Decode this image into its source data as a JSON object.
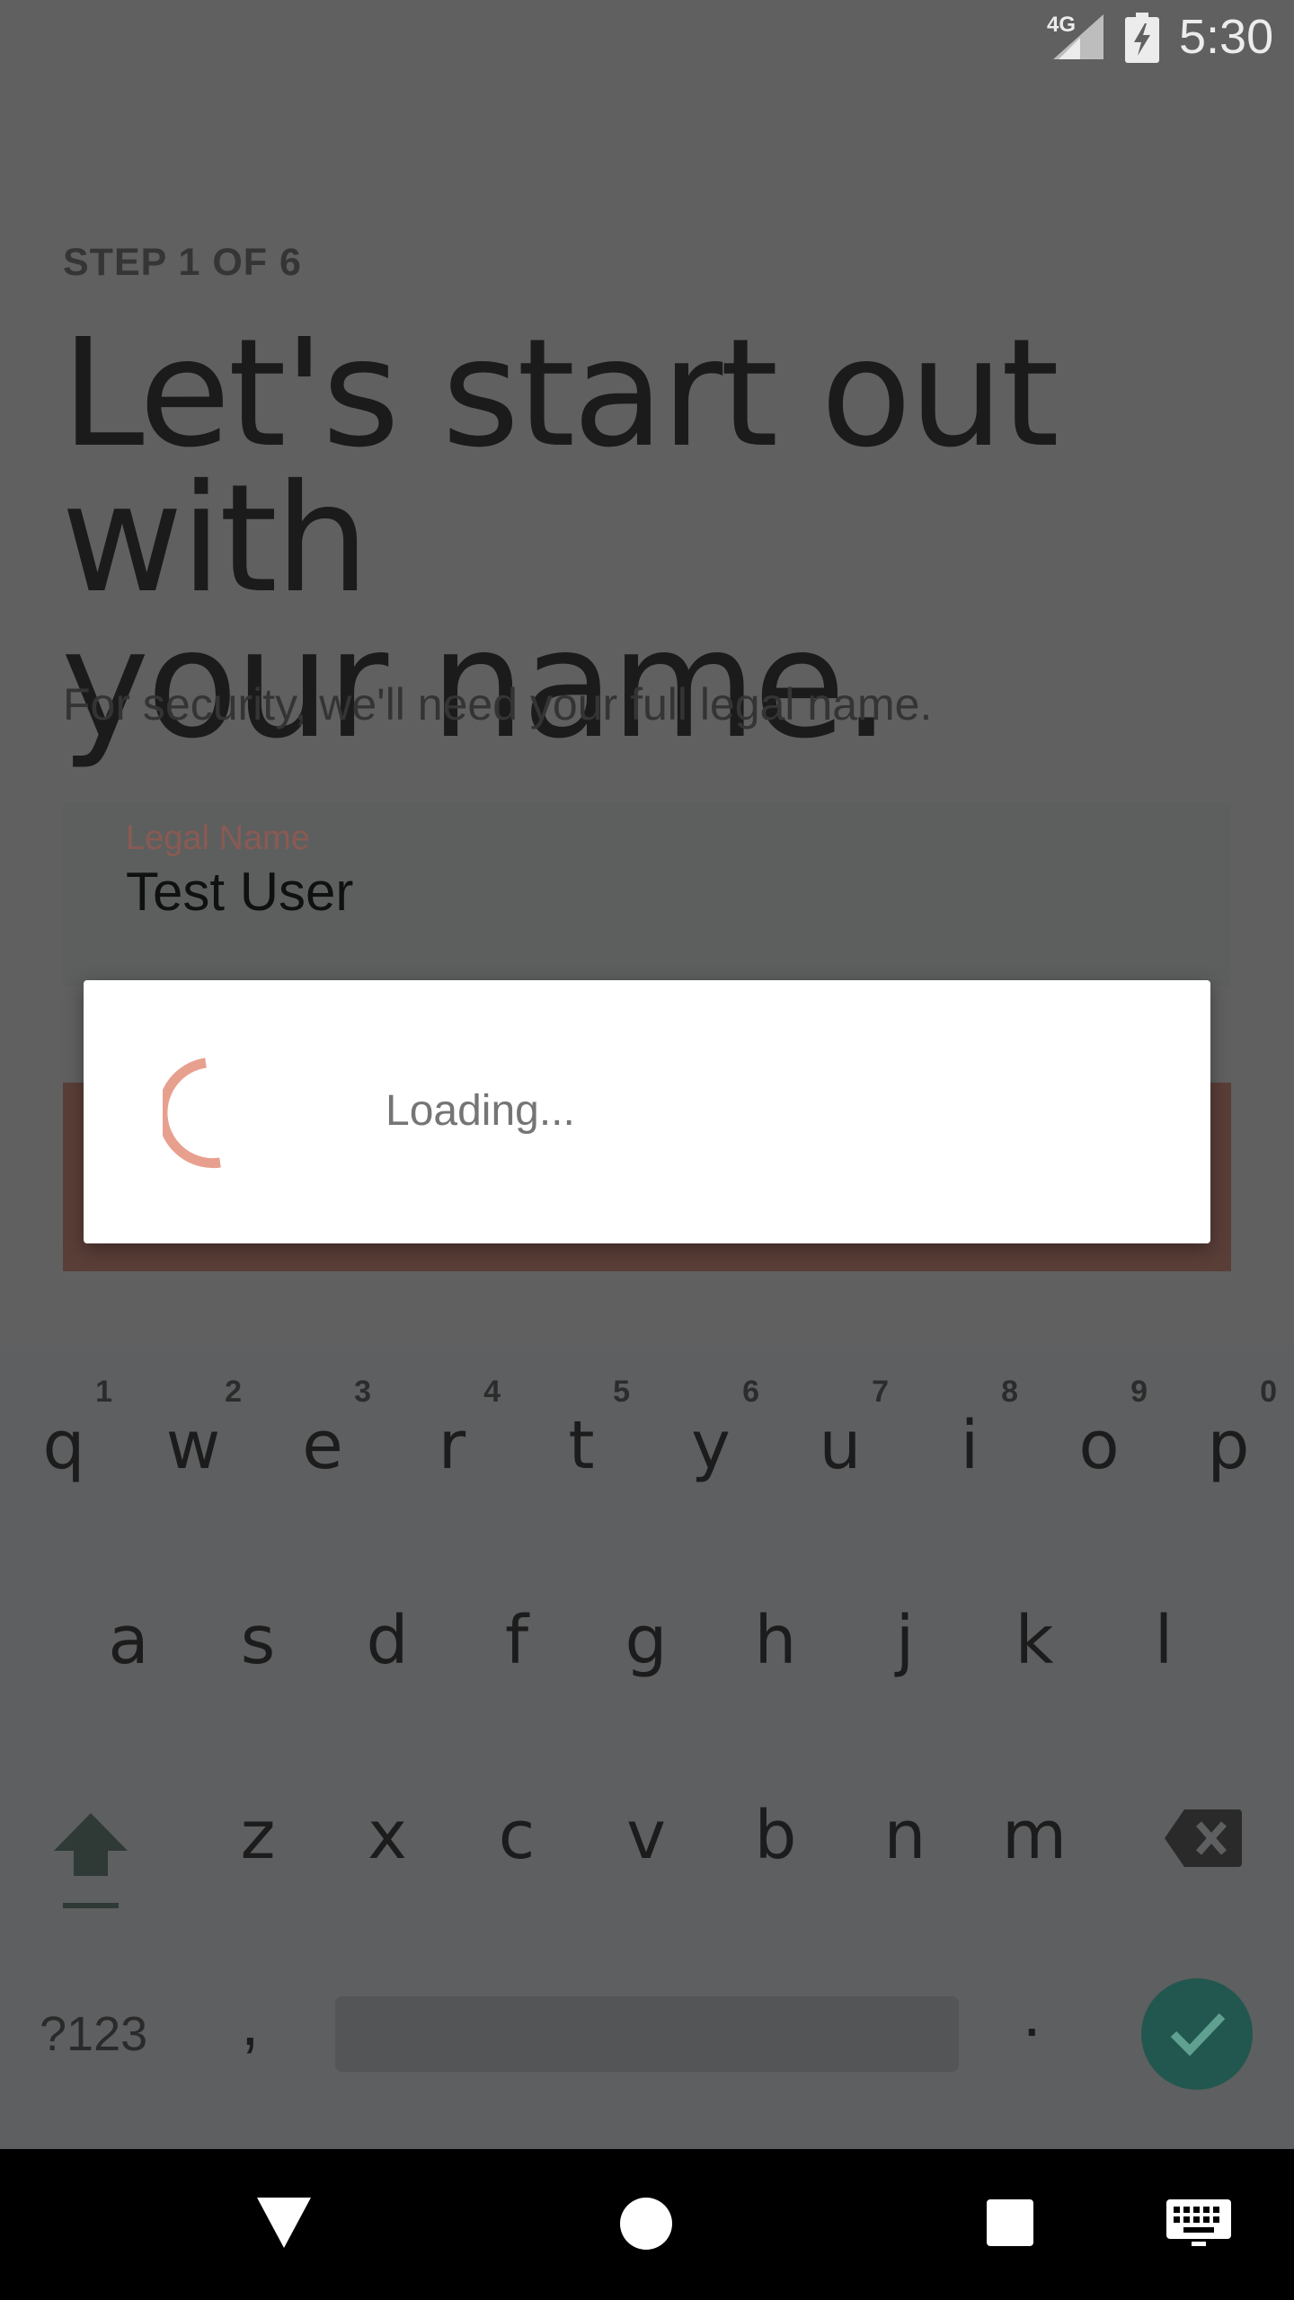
{
  "status_bar": {
    "network": "4G",
    "time": "5:30",
    "icons": [
      "signal-icon",
      "battery-charging-icon"
    ]
  },
  "page": {
    "step_label": "STEP 1 OF 6",
    "headline_line1": "Let's start out with",
    "headline_line2": "your name.",
    "subtext": "For security, we'll need your full legal name."
  },
  "form": {
    "field_label": "Legal Name",
    "field_value": "Test User"
  },
  "dialog": {
    "loading_text": "Loading..."
  },
  "keyboard": {
    "row1": [
      {
        "letter": "q",
        "hint": "1"
      },
      {
        "letter": "w",
        "hint": "2"
      },
      {
        "letter": "e",
        "hint": "3"
      },
      {
        "letter": "r",
        "hint": "4"
      },
      {
        "letter": "t",
        "hint": "5"
      },
      {
        "letter": "y",
        "hint": "6"
      },
      {
        "letter": "u",
        "hint": "7"
      },
      {
        "letter": "i",
        "hint": "8"
      },
      {
        "letter": "o",
        "hint": "9"
      },
      {
        "letter": "p",
        "hint": "0"
      }
    ],
    "row2": [
      "a",
      "s",
      "d",
      "f",
      "g",
      "h",
      "j",
      "k",
      "l"
    ],
    "row3": [
      "z",
      "x",
      "c",
      "v",
      "b",
      "n",
      "m"
    ],
    "symbols_label": "?123",
    "comma_label": ",",
    "period_label": ".",
    "icons": [
      "shift-icon",
      "backspace-icon",
      "enter-check-icon"
    ]
  },
  "nav_bar": {
    "icons": [
      "back-icon",
      "home-icon",
      "recents-icon",
      "keyboard-switch-icon"
    ]
  },
  "colors": {
    "accent": "#e8a08e",
    "enter_key": "#21574e",
    "scrim_background": "#606060"
  }
}
